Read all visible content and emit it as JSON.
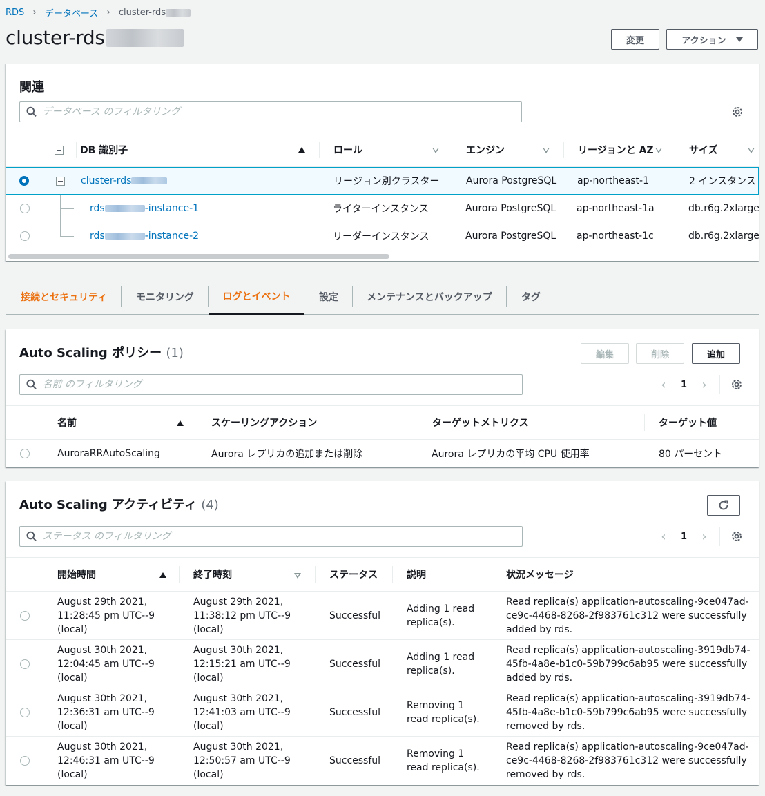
{
  "breadcrumb": {
    "root": "RDS",
    "databases": "データベース",
    "current": "cluster-rds"
  },
  "page": {
    "title": "cluster-rds",
    "modify_label": "変更",
    "actions_label": "アクション"
  },
  "related": {
    "title": "関連",
    "filter_placeholder": "データベース のフィルタリング",
    "columns": [
      "DB 識別子",
      "ロール",
      "エンジン",
      "リージョンと AZ",
      "サイズ"
    ],
    "rows": [
      {
        "id_prefix": "cluster-rds",
        "id_suffix": "",
        "role": "リージョン別クラスター",
        "engine": "Aurora PostgreSQL",
        "region": "ap-northeast-1",
        "size": "2 インスタンス"
      },
      {
        "id_prefix": "rds",
        "id_suffix": "-instance-1",
        "role": "ライターインスタンス",
        "engine": "Aurora PostgreSQL",
        "region": "ap-northeast-1a",
        "size": "db.r6g.2xlarge"
      },
      {
        "id_prefix": "rds",
        "id_suffix": "-instance-2",
        "role": "リーダーインスタンス",
        "engine": "Aurora PostgreSQL",
        "region": "ap-northeast-1c",
        "size": "db.r6g.2xlarge"
      }
    ]
  },
  "tabs": [
    "接続とセキュリティ",
    "モニタリング",
    "ログとイベント",
    "設定",
    "メンテナンスとバックアップ",
    "タグ"
  ],
  "policies": {
    "title": "Auto Scaling ポリシー",
    "count": "(1)",
    "edit_label": "編集",
    "delete_label": "削除",
    "add_label": "追加",
    "filter_placeholder": "名前 のフィルタリング",
    "page": "1",
    "columns": [
      "名前",
      "スケーリングアクション",
      "ターゲットメトリクス",
      "ターゲット値"
    ],
    "rows": [
      {
        "name": "AuroraRRAutoScaling",
        "action": "Aurora レプリカの追加または削除",
        "metric": "Aurora レプリカの平均 CPU 使用率",
        "value": "80 パーセント"
      }
    ]
  },
  "activities": {
    "title": "Auto Scaling アクティビティ",
    "count": "(4)",
    "filter_placeholder": "ステータス のフィルタリング",
    "page": "1",
    "columns": [
      "開始時間",
      "終了時刻",
      "ステータス",
      "説明",
      "状況メッセージ"
    ],
    "rows": [
      {
        "start": [
          "August 29th 2021,",
          "11:28:45 pm UTC--9",
          "(local)"
        ],
        "end": [
          "August 29th 2021,",
          "11:38:12 pm UTC--9",
          "(local)"
        ],
        "status": "Successful",
        "desc": [
          "Adding 1 read",
          "replica(s)."
        ],
        "msg": [
          "Read replica(s) application-autoscaling-9ce047ad-",
          "ce9c-4468-8268-2f983761c312 were successfully",
          "added by rds."
        ]
      },
      {
        "start": [
          "August 30th 2021,",
          "12:04:45 am UTC--9",
          "(local)"
        ],
        "end": [
          "August 30th 2021,",
          "12:15:21 am UTC--9",
          "(local)"
        ],
        "status": "Successful",
        "desc": [
          "Adding 1 read",
          "replica(s)."
        ],
        "msg": [
          "Read replica(s) application-autoscaling-3919db74-",
          "45fb-4a8e-b1c0-59b799c6ab95 were successfully",
          "added by rds."
        ]
      },
      {
        "start": [
          "August 30th 2021,",
          "12:36:31 am UTC--9",
          "(local)"
        ],
        "end": [
          "August 30th 2021,",
          "12:41:03 am UTC--9",
          "(local)"
        ],
        "status": "Successful",
        "desc": [
          "Removing 1",
          "read replica(s)."
        ],
        "msg": [
          "Read replica(s) application-autoscaling-3919db74-",
          "45fb-4a8e-b1c0-59b799c6ab95 were successfully",
          "removed by rds."
        ]
      },
      {
        "start": [
          "August 30th 2021,",
          "12:46:31 am UTC--9",
          "(local)"
        ],
        "end": [
          "August 30th 2021,",
          "12:50:57 am UTC--9",
          "(local)"
        ],
        "status": "Successful",
        "desc": [
          "Removing 1",
          "read replica(s)."
        ],
        "msg": [
          "Read replica(s) application-autoscaling-9ce047ad-",
          "ce9c-4468-8268-2f983761c312 were successfully",
          "removed by rds."
        ]
      }
    ]
  }
}
